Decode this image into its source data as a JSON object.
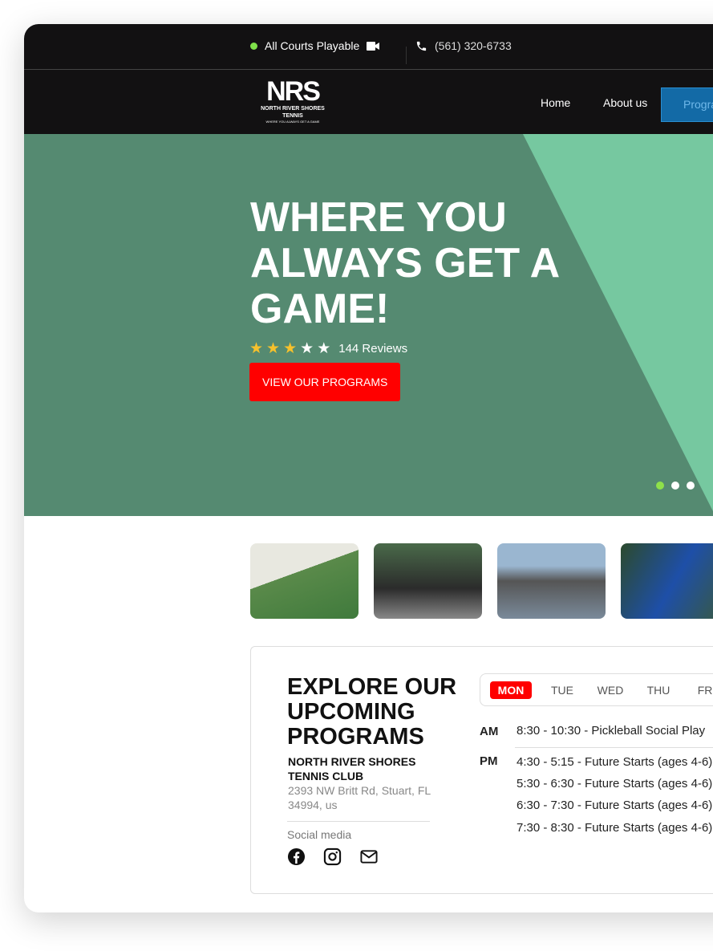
{
  "topbar": {
    "status": "All Courts Playable",
    "phone": "(561) 320-6733",
    "status_color": "#7fe04a"
  },
  "logo": {
    "letters": "NRS",
    "name": "NORTH RIVER SHORES",
    "sub": "TENNIS",
    "tagline": "WHERE YOU ALWAYS GET A GAME"
  },
  "nav": {
    "items": [
      "Home",
      "About us",
      "Programs"
    ]
  },
  "hero": {
    "title": "WHERE YOU ALWAYS GET A GAME!",
    "rating": 3,
    "rating_max": 5,
    "reviews": "144 Reviews",
    "cta": "VIEW OUR PROGRAMS",
    "slides": 3,
    "active_slide": 1
  },
  "programs": {
    "title": "EXPLORE OUR UPCOMING PROGRAMS",
    "club": "NORTH RIVER SHORES TENNIS CLUB",
    "address": "2393 NW Britt Rd, Stuart, FL 34994, us",
    "social_label": "Social media",
    "social": [
      "facebook-icon",
      "instagram-icon",
      "mail-icon"
    ],
    "days": [
      "MON",
      "TUE",
      "WED",
      "THU",
      "FRI"
    ],
    "active_day": "MON",
    "am_label": "AM",
    "pm_label": "PM",
    "am": [
      "8:30 - 10:30 - Pickleball Social Play"
    ],
    "pm": [
      "4:30 - 5:15 - Future Starts (ages 4-6)",
      "5:30 - 6:30 - Future Starts (ages 4-6)",
      "6:30 - 7:30 - Future Starts (ages 4-6)",
      "7:30 - 8:30 - Future Starts (ages 4-6)"
    ]
  },
  "colors": {
    "accent": "#ff0000",
    "nav_button": "#136aa6",
    "hero": "#558a71"
  }
}
